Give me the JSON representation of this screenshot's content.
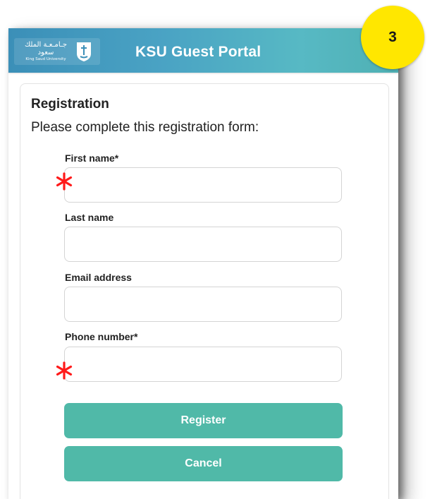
{
  "header": {
    "title": "KSU Guest Portal",
    "logo": {
      "arabic_name": "جـامـعـة الملك سعود",
      "english_name": "King Saud University",
      "icon": "university-emblem-icon"
    }
  },
  "step_badge": "3",
  "form": {
    "title": "Registration",
    "subtitle": "Please complete this registration form:",
    "fields": [
      {
        "label": "First name*",
        "value": "",
        "required_marker_icon": "red-asterisk-icon"
      },
      {
        "label": "Last name",
        "value": ""
      },
      {
        "label": "Email address",
        "value": ""
      },
      {
        "label": "Phone number*",
        "value": "",
        "required_marker_icon": "red-asterisk-icon"
      }
    ],
    "register_label": "Register",
    "cancel_label": "Cancel"
  },
  "colors": {
    "header_gradient_start": "#3b8fb8",
    "header_gradient_end": "#4fb0b3",
    "button": "#50b9a8",
    "badge": "#ffe700",
    "required_marker": "#ff1a1a"
  }
}
